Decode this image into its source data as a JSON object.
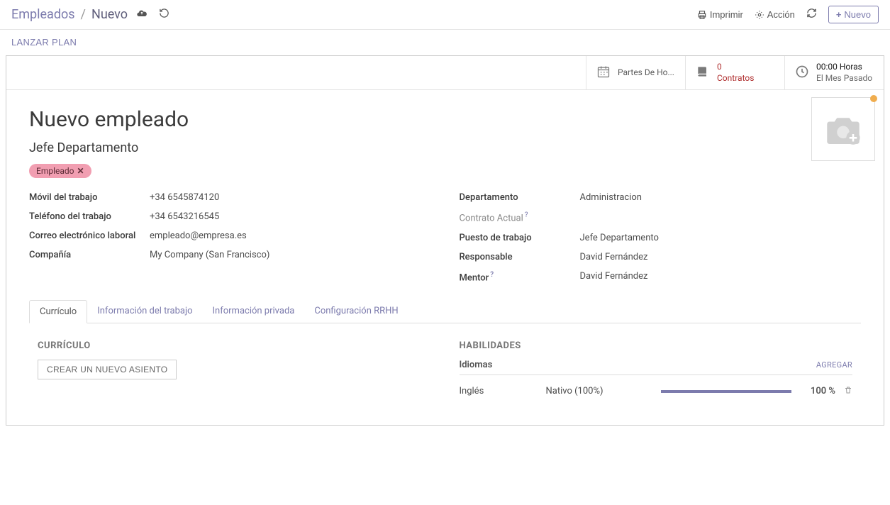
{
  "breadcrumb": {
    "parent": "Empleados",
    "current": "Nuevo"
  },
  "controls": {
    "print": "Imprimir",
    "action": "Acción",
    "new": "Nuevo"
  },
  "subbar": {
    "lanzar_plan": "LANZAR PLAN"
  },
  "stats": {
    "timesheets": {
      "label": "Partes De Ho..."
    },
    "contracts": {
      "count": "0",
      "label": "Contratos"
    },
    "hours": {
      "primary": "00:00 Horas",
      "secondary": "El Mes Pasado"
    }
  },
  "employee": {
    "name": "Nuevo empleado",
    "job_title": "Jefe Departamento"
  },
  "tags": {
    "0": {
      "label": "Empleado"
    }
  },
  "fields_left": {
    "mobile_label": "Móvil del trabajo",
    "mobile_value": "+34 6545874120",
    "phone_label": "Teléfono del trabajo",
    "phone_value": "+34 6543216545",
    "email_label": "Correo electrónico laboral",
    "email_value": "empleado@empresa.es",
    "company_label": "Compañía",
    "company_value": "My Company (San Francisco)"
  },
  "fields_right": {
    "dept_label": "Departamento",
    "dept_value": "Administracion",
    "contract_label": "Contrato Actual",
    "position_label": "Puesto de trabajo",
    "position_value": "Jefe Departamento",
    "manager_label": "Responsable",
    "manager_value": "David Fernández",
    "mentor_label": "Mentor",
    "mentor_value": "David Fernández"
  },
  "tabs": {
    "curriculo": "Currículo",
    "info_trabajo": "Información del trabajo",
    "info_privada": "Información privada",
    "config_rrhh": "Configuración RRHH"
  },
  "curriculo_section": {
    "title": "CURRÍCULO",
    "create_btn": "CREAR UN NUEVO ASIENTO"
  },
  "skills_section": {
    "title": "HABILIDADES",
    "group": "Idiomas",
    "add": "AGREGAR",
    "items": {
      "0": {
        "name": "Inglés",
        "level": "Nativo (100%)",
        "pct": "100 %"
      }
    }
  }
}
